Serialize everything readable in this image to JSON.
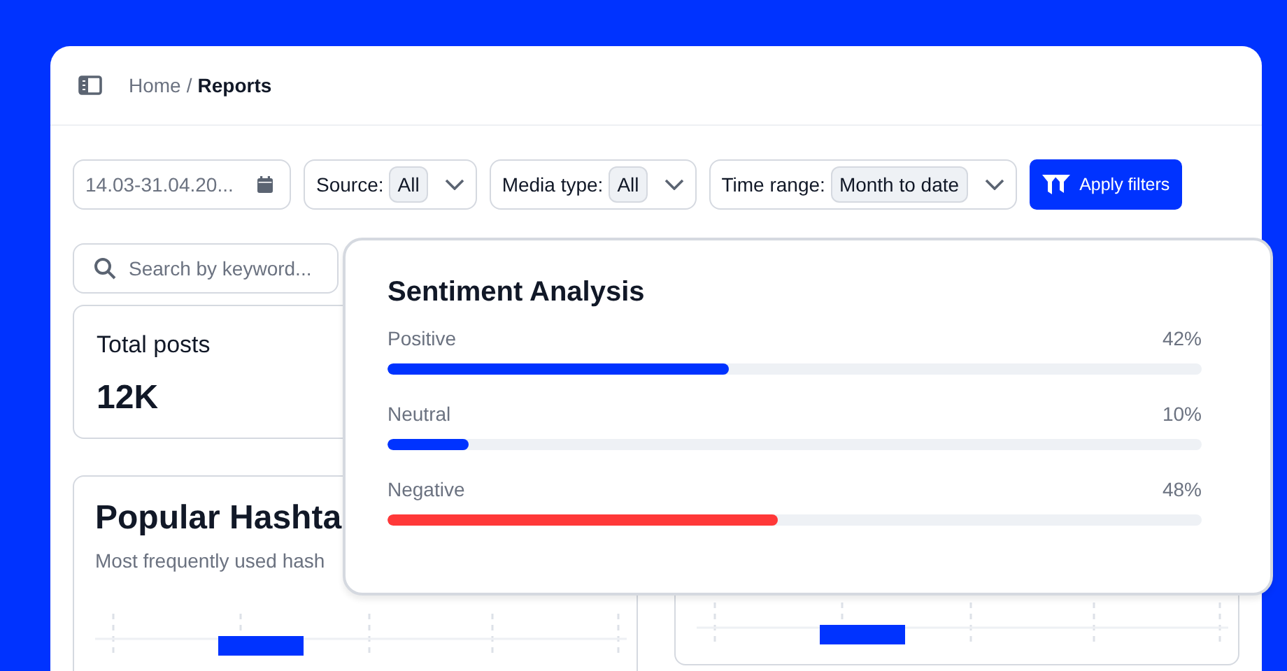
{
  "breadcrumb": {
    "parent": "Home",
    "separator": "/",
    "current": "Reports"
  },
  "filters": {
    "date_range": "14.03-31.04.20...",
    "dropdowns": [
      {
        "label": "Source:",
        "value": "All"
      },
      {
        "label": "Media type:",
        "value": "All"
      },
      {
        "label": "Time range:",
        "value": "Month to date"
      }
    ],
    "apply_button": "Apply filters"
  },
  "search": {
    "placeholder": "Search by keyword..."
  },
  "total_posts": {
    "label": "Total posts",
    "value": "12K"
  },
  "popular_hashtags": {
    "title": "Popular Hashta",
    "subtitle": "Most frequently used hash"
  },
  "sentiment": {
    "title": "Sentiment Analysis",
    "items": [
      {
        "label": "Positive",
        "reading": "42%",
        "level": 0.42,
        "color": "#0033ff"
      },
      {
        "label": "Neutral",
        "reading": "10%",
        "level": 0.1,
        "color": "#0033ff"
      },
      {
        "label": "Negative",
        "reading": "48%",
        "level": 0.48,
        "color": "#ff3838"
      }
    ]
  }
}
